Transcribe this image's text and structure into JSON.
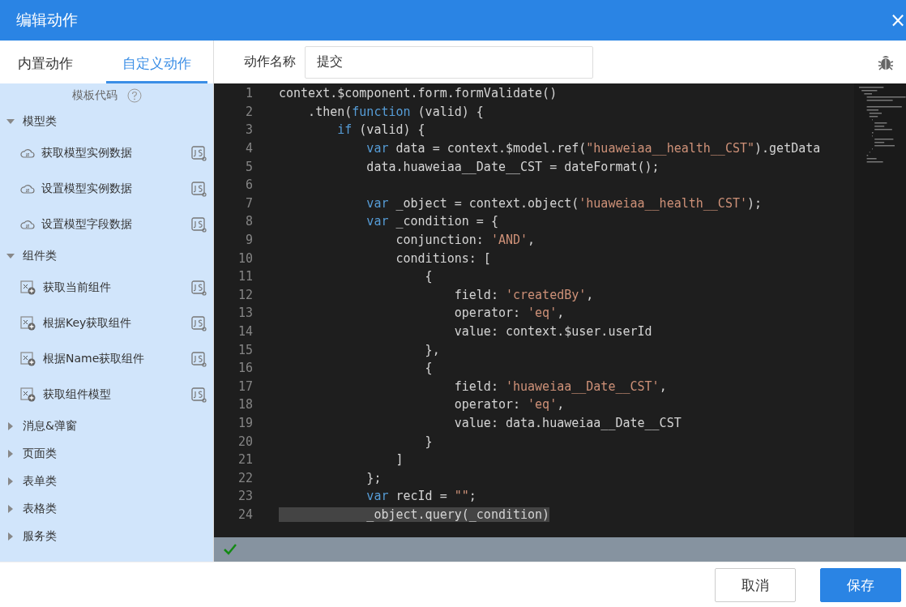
{
  "window": {
    "title": "编辑动作",
    "close": "×"
  },
  "tabs": [
    {
      "label": "内置动作",
      "selected": false
    },
    {
      "label": "自定义动作",
      "selected": true
    }
  ],
  "sidebar": {
    "heading": "模板代码",
    "groups": [
      {
        "label": "模型类",
        "expanded": true,
        "items": [
          {
            "label": "获取模型实例数据",
            "kind": "model"
          },
          {
            "label": "设置模型实例数据",
            "kind": "model"
          },
          {
            "label": "设置模型字段数据",
            "kind": "model"
          }
        ]
      },
      {
        "label": "组件类",
        "expanded": true,
        "items": [
          {
            "label": "获取当前组件",
            "kind": "component"
          },
          {
            "label": "根据Key获取组件",
            "kind": "component"
          },
          {
            "label": "根据Name获取组件",
            "kind": "component"
          },
          {
            "label": "获取组件模型",
            "kind": "component"
          }
        ]
      },
      {
        "label": "消息&弹窗",
        "expanded": false
      },
      {
        "label": "页面类",
        "expanded": false
      },
      {
        "label": "表单类",
        "expanded": false
      },
      {
        "label": "表格类",
        "expanded": false
      },
      {
        "label": "服务类",
        "expanded": false
      }
    ]
  },
  "action_name": {
    "label": "动作名称",
    "value": "提交"
  },
  "editor": {
    "lines": [
      {
        "number": "1",
        "tokens": [
          {
            "kind": "plain",
            "text": "context.$component.form.formValidate()"
          }
        ]
      },
      {
        "number": "2",
        "tokens": [
          {
            "kind": "plain",
            "text": "    .then("
          },
          {
            "kind": "keyword",
            "text": "function"
          },
          {
            "kind": "plain",
            "text": " (valid) {"
          }
        ]
      },
      {
        "number": "3",
        "tokens": [
          {
            "kind": "keyword",
            "text": "        if"
          },
          {
            "kind": "plain",
            "text": " (valid) {"
          }
        ]
      },
      {
        "number": "4",
        "tokens": [
          {
            "kind": "keyword",
            "text": "            var"
          },
          {
            "kind": "plain",
            "text": " data = context.$model.ref("
          },
          {
            "kind": "string",
            "text": "\"huaweiaa__health__CST\""
          },
          {
            "kind": "plain",
            "text": ").getData"
          }
        ]
      },
      {
        "number": "5",
        "tokens": [
          {
            "kind": "plain",
            "text": "            data.huaweiaa__Date__CST = dateFormat();"
          }
        ]
      },
      {
        "number": "6"
      },
      {
        "number": "7",
        "tokens": [
          {
            "kind": "keyword",
            "text": "            var"
          },
          {
            "kind": "plain",
            "text": " _object = context.object("
          },
          {
            "kind": "string",
            "text": "'huaweiaa__health__CST'"
          },
          {
            "kind": "plain",
            "text": ");"
          }
        ]
      },
      {
        "number": "8",
        "tokens": [
          {
            "kind": "keyword",
            "text": "            var"
          },
          {
            "kind": "plain",
            "text": " _condition = {"
          }
        ]
      },
      {
        "number": "9",
        "tokens": [
          {
            "kind": "plain",
            "text": "                conjunction: "
          },
          {
            "kind": "string",
            "text": "'AND'"
          },
          {
            "kind": "plain",
            "text": ","
          }
        ]
      },
      {
        "number": "10",
        "tokens": [
          {
            "kind": "plain",
            "text": "                conditions: ["
          }
        ]
      },
      {
        "number": "11",
        "tokens": [
          {
            "kind": "plain",
            "text": "                    {"
          }
        ]
      },
      {
        "number": "12",
        "tokens": [
          {
            "kind": "plain",
            "text": "                        field: "
          },
          {
            "kind": "string",
            "text": "'createdBy'"
          },
          {
            "kind": "plain",
            "text": ","
          }
        ]
      },
      {
        "number": "13",
        "tokens": [
          {
            "kind": "plain",
            "text": "                        operator: "
          },
          {
            "kind": "string",
            "text": "'eq'"
          },
          {
            "kind": "plain",
            "text": ","
          }
        ]
      },
      {
        "number": "14",
        "tokens": [
          {
            "kind": "plain",
            "text": "                        value: context.$user.userId"
          }
        ]
      },
      {
        "number": "15",
        "tokens": [
          {
            "kind": "plain",
            "text": "                    },"
          }
        ]
      },
      {
        "number": "16",
        "tokens": [
          {
            "kind": "plain",
            "text": "                    {"
          }
        ]
      },
      {
        "number": "17",
        "tokens": [
          {
            "kind": "plain",
            "text": "                        field: "
          },
          {
            "kind": "string",
            "text": "'huaweiaa__Date__CST'"
          },
          {
            "kind": "plain",
            "text": ","
          }
        ]
      },
      {
        "number": "18",
        "tokens": [
          {
            "kind": "plain",
            "text": "                        operator: "
          },
          {
            "kind": "string",
            "text": "'eq'"
          },
          {
            "kind": "plain",
            "text": ","
          }
        ]
      },
      {
        "number": "19",
        "tokens": [
          {
            "kind": "plain",
            "text": "                        value: data.huaweiaa__Date__CST"
          }
        ]
      },
      {
        "number": "20",
        "tokens": [
          {
            "kind": "plain",
            "text": "                    }"
          }
        ]
      },
      {
        "number": "21",
        "tokens": [
          {
            "kind": "plain",
            "text": "                ]"
          }
        ]
      },
      {
        "number": "22",
        "tokens": [
          {
            "kind": "plain",
            "text": "            };"
          }
        ]
      },
      {
        "number": "23",
        "tokens": [
          {
            "kind": "keyword",
            "text": "            var"
          },
          {
            "kind": "plain",
            "text": " recId = "
          },
          {
            "kind": "string",
            "text": "\"\""
          },
          {
            "kind": "plain",
            "text": ";"
          }
        ]
      },
      {
        "number": "24",
        "tokens": [
          {
            "kind": "plain",
            "text": "            _object.query(_condition)"
          }
        ]
      }
    ]
  },
  "buttons": [
    {
      "label": "取消",
      "kind": "secondary"
    },
    {
      "label": "保存",
      "kind": "primary"
    }
  ]
}
